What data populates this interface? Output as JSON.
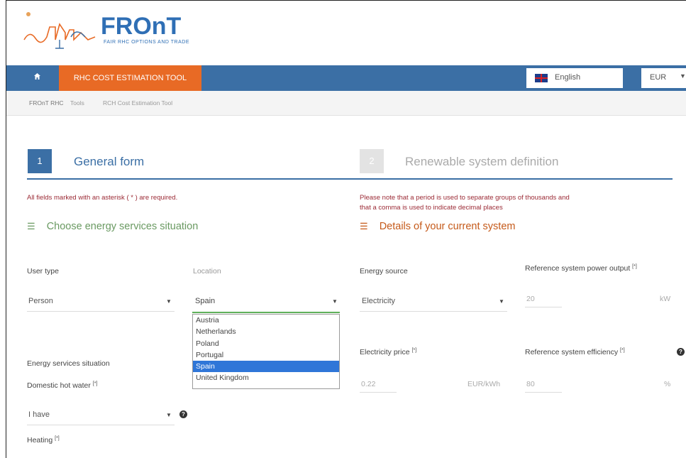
{
  "brand": {
    "name": "FROnT",
    "tagline": "FAIR RHC OPTIONS AND TRADE"
  },
  "nav": {
    "home_icon": "home-icon",
    "tool_tab": "RHC COST ESTIMATION TOOL",
    "language": "English",
    "currency": "EUR"
  },
  "breadcrumb": [
    "FROnT RHC",
    "Tools",
    "RCH Cost Estimation Tool"
  ],
  "steps": [
    {
      "number": "1",
      "title": "General form"
    },
    {
      "number": "2",
      "title": "Renewable system definition"
    }
  ],
  "notes": {
    "required": "All fields marked with an asterisk ( * ) are required.",
    "decimal_line1": "Please note that a period is used to separate groups of thousands and",
    "decimal_line2": "that a comma is used to indicate decimal places"
  },
  "sections": {
    "left": "Choose energy services situation",
    "right": "Details of your current system"
  },
  "left_form": {
    "user_type_label": "User type",
    "user_type_value": "Person",
    "location_label": "Location",
    "location_value": "Spain",
    "location_options": [
      "Austria",
      "Netherlands",
      "Poland",
      "Portugal",
      "Spain",
      "United Kingdom"
    ],
    "location_selected": "Spain",
    "energy_services_label": "Energy services situation",
    "dhw_label": "Domestic hot water",
    "dhw_value": "I have",
    "heating_label": "Heating",
    "required_mark": "[*]"
  },
  "right_form": {
    "energy_source_label": "Energy source",
    "energy_source_value": "Electricity",
    "ref_power_label": "Reference system power output",
    "ref_power_value": "20",
    "ref_power_unit": "kW",
    "price_label": "Electricity price",
    "price_value": "0.22",
    "price_unit": "EUR/kWh",
    "efficiency_label": "Reference system efficiency",
    "efficiency_value": "80",
    "efficiency_unit": "%",
    "required_mark": "[*]"
  },
  "colors": {
    "primary": "#3b6fa5",
    "accent": "#e86a25",
    "required": "#9b2a35",
    "green": "#6a9a62",
    "selected": "#2f76d8"
  }
}
